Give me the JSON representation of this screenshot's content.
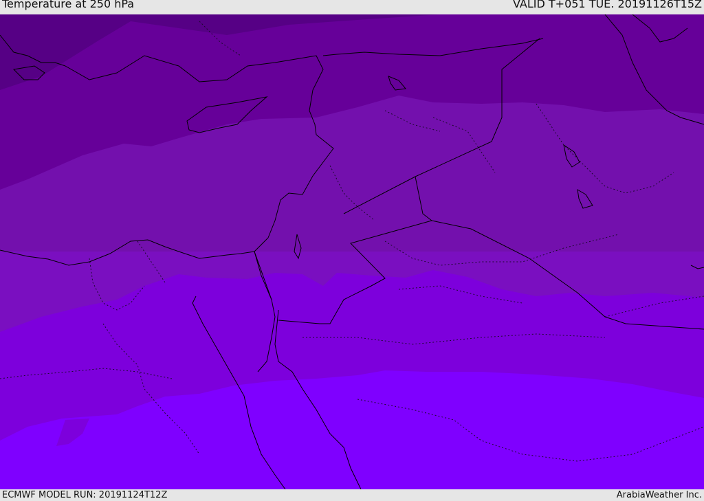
{
  "header": {
    "title": "Temperature at 250 hPa",
    "valid": "VALID T+051 TUE. 20191126T15Z"
  },
  "footer": {
    "model_run": "ECMWF MODEL RUN: 20191124T12Z",
    "credit": "ArabiaWeather Inc."
  },
  "colors": {
    "band_coldest": "#560085",
    "band_1": "#660099",
    "band_2": "#7310ad",
    "band_3": "#7a0fc0",
    "band_4": "#7d00dc",
    "band_warmest": "#7f00ff",
    "coastline": "#000000",
    "border": "#1a0a2a"
  }
}
